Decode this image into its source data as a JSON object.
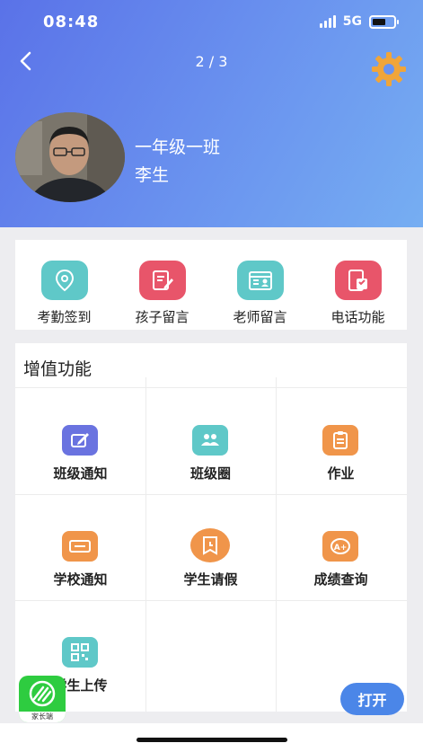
{
  "status_bar": {
    "time": "08:48",
    "network": "5G"
  },
  "header": {
    "page_indicator": "2 / 3"
  },
  "profile": {
    "class_name": "一年级一班",
    "student_name": "李生"
  },
  "quick_actions": [
    {
      "label": "考勤签到",
      "icon": "location-pin-icon",
      "color": "#5fc8c8"
    },
    {
      "label": "孩子留言",
      "icon": "edit-note-icon",
      "color": "#e8556a"
    },
    {
      "label": "老师留言",
      "icon": "calendar-contact-icon",
      "color": "#5fc8c8"
    },
    {
      "label": "电话功能",
      "icon": "phone-card-icon",
      "color": "#e8556a"
    }
  ],
  "value_added": {
    "title": "增值功能",
    "items": [
      {
        "label": "班级通知",
        "icon": "class-notice-icon",
        "color": "#6a73e0"
      },
      {
        "label": "班级圈",
        "icon": "class-circle-icon",
        "color": "#5fc8c8"
      },
      {
        "label": "作业",
        "icon": "homework-icon",
        "color": "#f0954a"
      },
      {
        "label": "学校通知",
        "icon": "school-notice-icon",
        "color": "#f0954a"
      },
      {
        "label": "学生请假",
        "icon": "student-leave-icon",
        "color": "#f0954a"
      },
      {
        "label": "成绩查询",
        "icon": "grade-query-icon",
        "color": "#f0954a"
      },
      {
        "label": "学生上传",
        "icon": "qr-upload-icon",
        "color": "#5fc8c8"
      }
    ]
  },
  "floating": {
    "app_name": "家长端",
    "open_label": "打开"
  }
}
